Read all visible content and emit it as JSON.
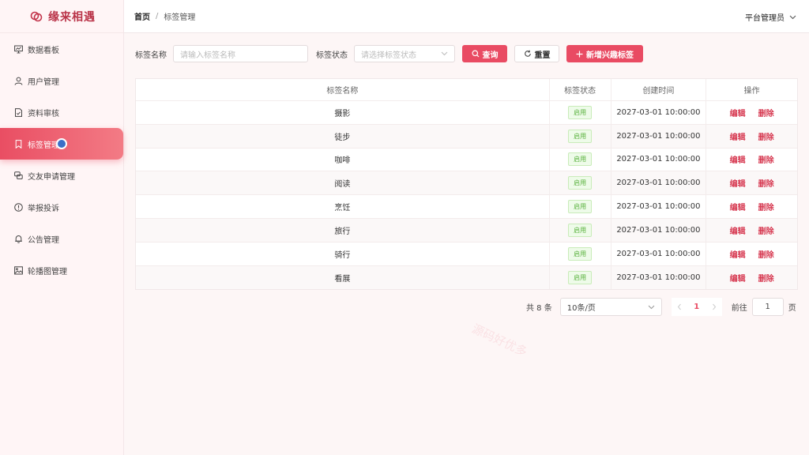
{
  "app": {
    "name": "缘来相遇"
  },
  "sidebar": {
    "items": [
      {
        "label": "数据看板",
        "icon": "dashboard-icon"
      },
      {
        "label": "用户管理",
        "icon": "user-icon"
      },
      {
        "label": "资料审核",
        "icon": "document-check-icon"
      },
      {
        "label": "标签管理",
        "icon": "bookmark-icon",
        "active": true
      },
      {
        "label": "交友申请管理",
        "icon": "chat-icon"
      },
      {
        "label": "举报投诉",
        "icon": "alert-icon"
      },
      {
        "label": "公告管理",
        "icon": "bell-icon"
      },
      {
        "label": "轮播图管理",
        "icon": "image-icon"
      }
    ]
  },
  "header": {
    "breadcrumb_home": "首页",
    "breadcrumb_sep": "/",
    "breadcrumb_current": "标签管理",
    "user": "平台管理员"
  },
  "filters": {
    "name_label": "标签名称",
    "name_placeholder": "请输入标签名称",
    "status_label": "标签状态",
    "status_placeholder": "请选择标签状态",
    "search_label": "查询",
    "reset_label": "重置",
    "add_label": "新增兴趣标签"
  },
  "table": {
    "headers": [
      "标签名称",
      "标签状态",
      "创建时间",
      "操作"
    ],
    "rows": [
      {
        "name": "摄影",
        "status": "启用",
        "created": "2027-03-01 10:00:00"
      },
      {
        "name": "徒步",
        "status": "启用",
        "created": "2027-03-01 10:00:00"
      },
      {
        "name": "咖啡",
        "status": "启用",
        "created": "2027-03-01 10:00:00"
      },
      {
        "name": "阅读",
        "status": "启用",
        "created": "2027-03-01 10:00:00"
      },
      {
        "name": "烹饪",
        "status": "启用",
        "created": "2027-03-01 10:00:00"
      },
      {
        "name": "旅行",
        "status": "启用",
        "created": "2027-03-01 10:00:00"
      },
      {
        "name": "骑行",
        "status": "启用",
        "created": "2027-03-01 10:00:00"
      },
      {
        "name": "看展",
        "status": "启用",
        "created": "2027-03-01 10:00:00"
      }
    ],
    "edit_label": "编辑",
    "delete_label": "删除"
  },
  "pagination": {
    "total": "共 8 条",
    "page_size": "10条/页",
    "current_page": "1",
    "goto_label": "前往",
    "goto_value": "1",
    "page_suffix": "页"
  },
  "watermark": "源码好优多",
  "colors": {
    "accent": "#e94b63",
    "brand": "#b93247",
    "success": "#57b03a"
  }
}
